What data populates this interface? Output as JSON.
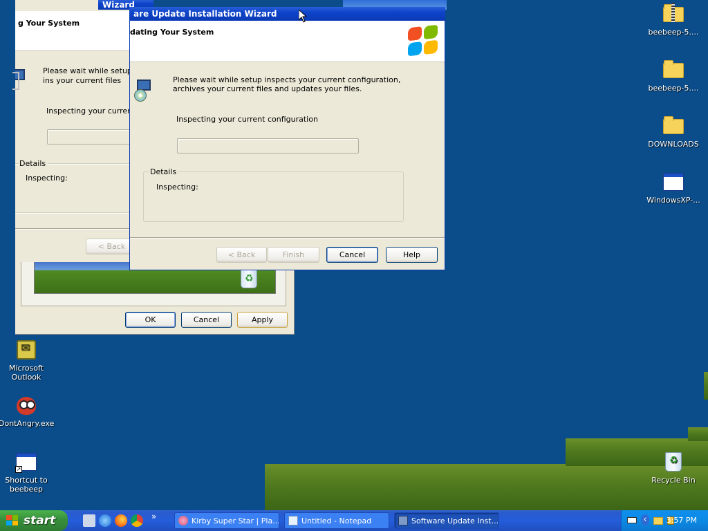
{
  "desktop": {
    "icons_right": [
      {
        "label": "beebeep-5...."
      },
      {
        "label": "beebeep-5...."
      },
      {
        "label": "DOWNLOADS"
      },
      {
        "label": "WindowsXP-..."
      },
      {
        "label": "Recycle Bin"
      }
    ],
    "icons_left": [
      {
        "label": "Microsoft Outlook"
      },
      {
        "label": "DontAngry.exe"
      },
      {
        "label": "Shortcut to beebeep"
      }
    ]
  },
  "wizard_back": {
    "title": "Wizard",
    "header_title": "g Your System",
    "body_text": "Please wait while setup ins your current files and upda",
    "status_text": "Inspecting your current co",
    "details_label": "Details",
    "details_text": "Inspecting:",
    "back_button": "< Back"
  },
  "wizard_front": {
    "title": "are Update Installation Wizard",
    "header_title": "dating Your System",
    "body_text": "Please wait while setup inspects your current configuration, archives your current files and updates your files.",
    "status_text": "Inspecting your current configuration",
    "progress": 0,
    "details_label": "Details",
    "details_text": "Inspecting:",
    "buttons": {
      "back": "< Back",
      "finish": "Finish",
      "cancel": "Cancel",
      "help": "Help"
    }
  },
  "properties_dialog": {
    "buttons": {
      "ok": "OK",
      "cancel": "Cancel",
      "apply": "Apply"
    }
  },
  "taskbar": {
    "start_label": "start",
    "overflow": "»",
    "windows": [
      {
        "label": "Kirby Super Star | Pla...",
        "icon": "kirby-icon"
      },
      {
        "label": "Untitled - Notepad",
        "icon": "notepad-icon"
      },
      {
        "label": "Software Update Inst...",
        "icon": "setup-icon",
        "active": true
      }
    ],
    "tray_expand": "‹",
    "clock": "3:57 PM"
  },
  "colors": {
    "desktop": "#0b4d8a",
    "titlebar": "#0d43c9",
    "window_face": "#ece9d8",
    "taskbar": "#245edb",
    "start_button": "#388e3c"
  }
}
